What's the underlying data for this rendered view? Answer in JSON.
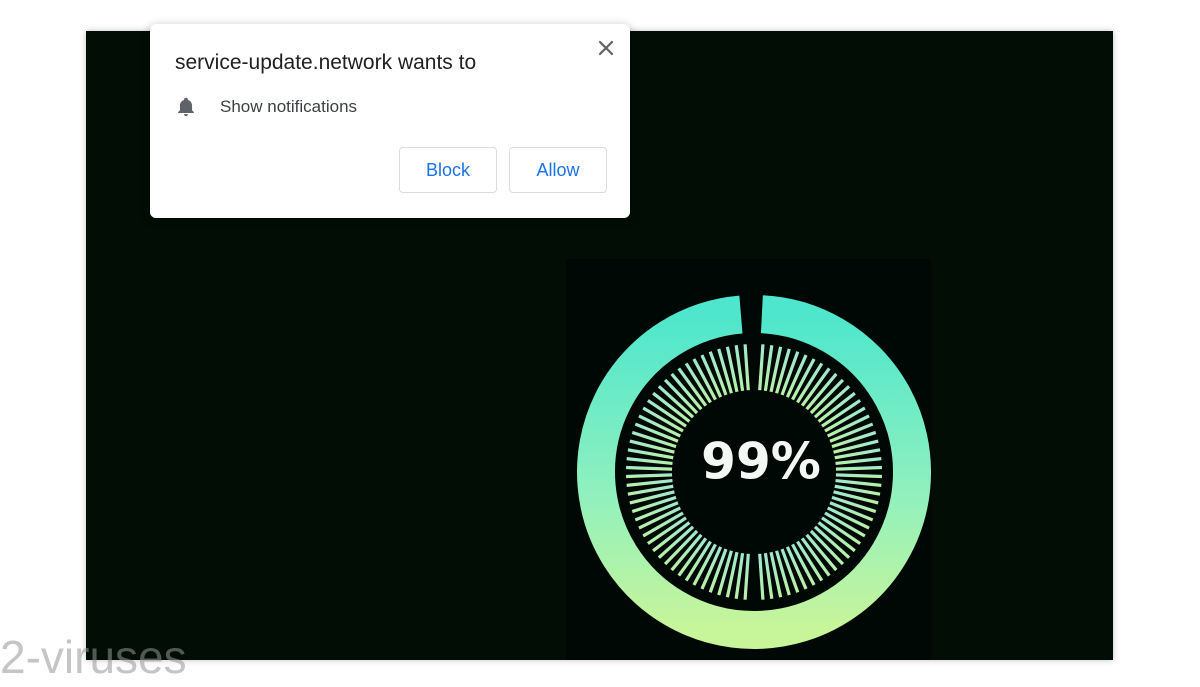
{
  "popup": {
    "title": "service-update.network wants to",
    "permission_label": "Show notifications",
    "permission_icon": "bell-icon",
    "close_icon": "close-icon",
    "block_label": "Block",
    "allow_label": "Allow",
    "button_color": "#1a73e8"
  },
  "loader": {
    "percent_label": "99%",
    "progress": 0.99,
    "ring_color_top": "#4ee6cc",
    "ring_color_bottom": "#c8f59a",
    "background_color": "#020e05"
  },
  "watermark": {
    "text": "2-viruses"
  }
}
